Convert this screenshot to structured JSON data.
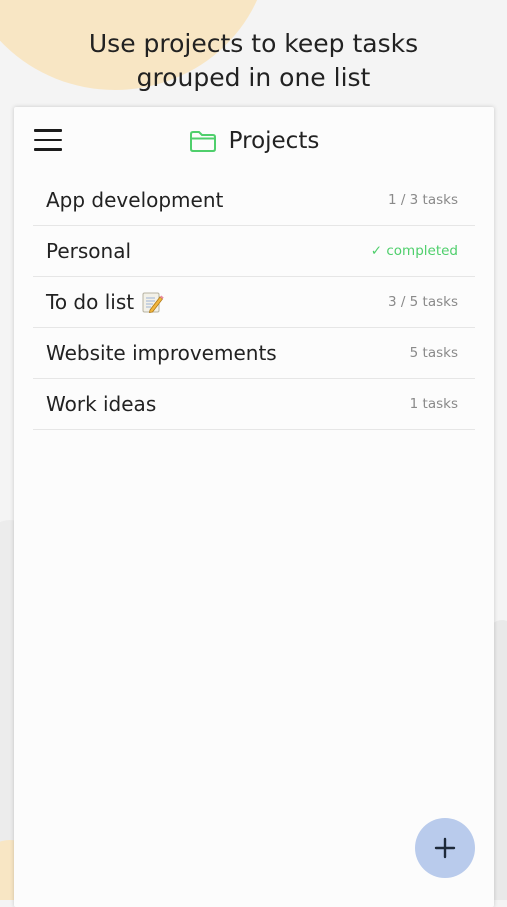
{
  "headline": {
    "line1": "Use projects to keep tasks",
    "line2": "grouped in one list"
  },
  "header": {
    "menu_icon": "hamburger-menu-icon",
    "folder_icon": "folder-icon",
    "title": "Projects"
  },
  "projects": [
    {
      "name": "App development",
      "status": "1 / 3 tasks"
    },
    {
      "name": "Personal",
      "status": "✓ completed",
      "completed": true
    },
    {
      "name": "To do list",
      "status": "3 / 5 tasks",
      "icon": "memo-emoji-icon"
    },
    {
      "name": "Website improvements",
      "status": "5 tasks"
    },
    {
      "name": "Work ideas",
      "status": "1 tasks"
    }
  ],
  "fab": {
    "icon": "plus-icon"
  },
  "colors": {
    "accent_green": "#4fcf6c",
    "fab_blue": "#b9cbec",
    "background_peach": "#f8e6c4"
  }
}
